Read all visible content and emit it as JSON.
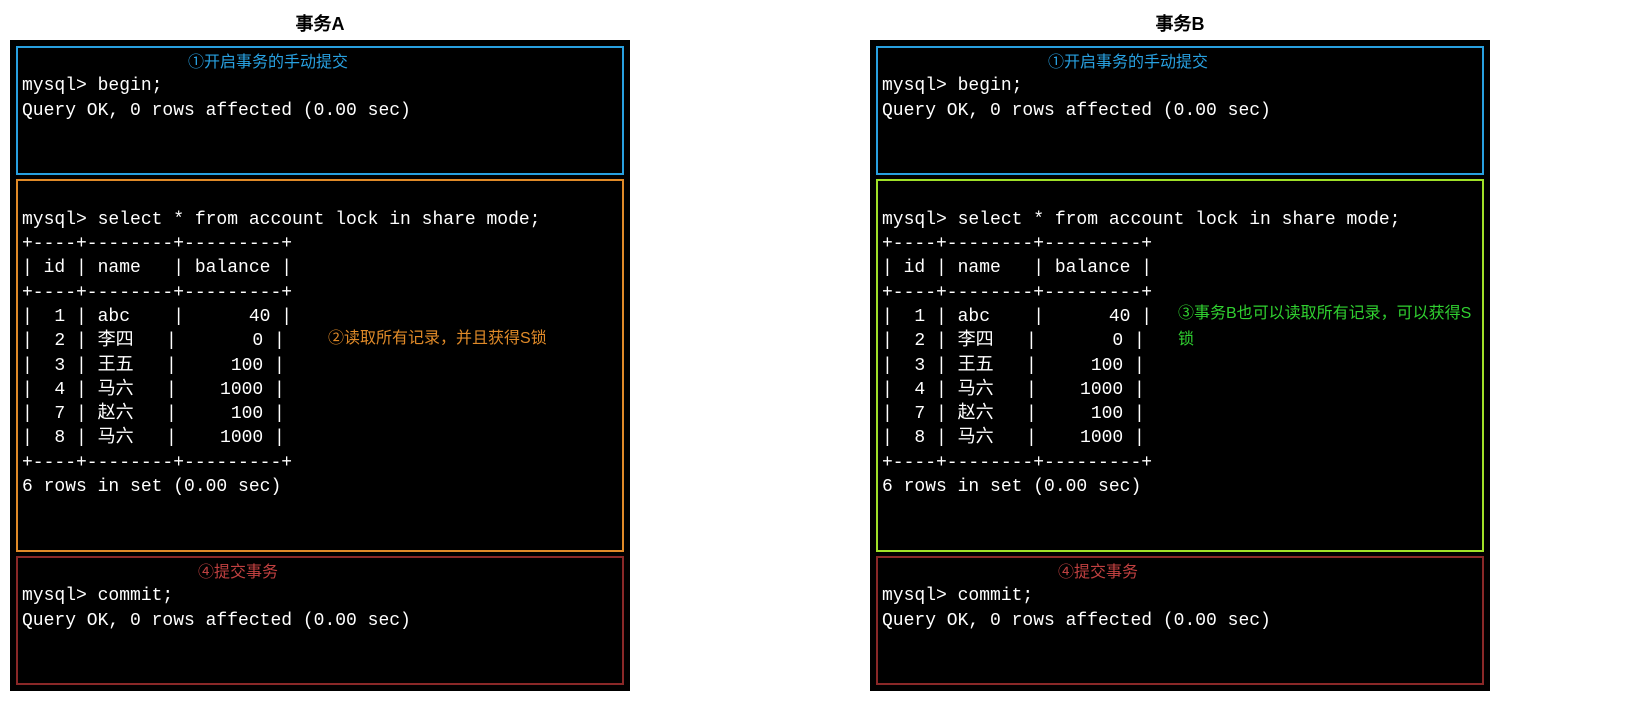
{
  "txA": {
    "title": "事务A",
    "begin": {
      "cmd": "mysql> begin;",
      "result": "Query OK, 0 rows affected (0.00 sec)",
      "annot": "①开启事务的手动提交"
    },
    "select": {
      "cmd": "mysql> select * from account lock in share mode;",
      "sep": "+----+--------+---------+",
      "header": "| id | name   | balance |",
      "rows": [
        "|  1 | abc    |      40 |",
        "|  2 | 李四   |       0 |",
        "|  3 | 王五   |     100 |",
        "|  4 | 马六   |    1000 |",
        "|  7 | 赵六   |     100 |",
        "|  8 | 马六   |    1000 |"
      ],
      "footer": "6 rows in set (0.00 sec)",
      "annot": "②读取所有记录，并且获得S锁"
    },
    "commit": {
      "cmd": "mysql> commit;",
      "result": "Query OK, 0 rows affected (0.00 sec)",
      "annot": "④提交事务"
    }
  },
  "txB": {
    "title": "事务B",
    "begin": {
      "cmd": "mysql> begin;",
      "result": "Query OK, 0 rows affected (0.00 sec)",
      "annot": "①开启事务的手动提交"
    },
    "select": {
      "cmd": "mysql> select * from account lock in share mode;",
      "sep": "+----+--------+---------+",
      "header": "| id | name   | balance |",
      "rows": [
        "|  1 | abc    |      40 |",
        "|  2 | 李四   |       0 |",
        "|  3 | 王五   |     100 |",
        "|  4 | 马六   |    1000 |",
        "|  7 | 赵六   |     100 |",
        "|  8 | 马六   |    1000 |"
      ],
      "footer": "6 rows in set (0.00 sec)",
      "annot": "③事务B也可以读取所有记录，可以获得S锁"
    },
    "commit": {
      "cmd": "mysql> commit;",
      "result": "Query OK, 0 rows affected (0.00 sec)",
      "annot": "④提交事务"
    }
  },
  "chart_data": {
    "type": "table",
    "title": "account",
    "columns": [
      "id",
      "name",
      "balance"
    ],
    "rows": [
      [
        1,
        "abc",
        40
      ],
      [
        2,
        "李四",
        0
      ],
      [
        3,
        "王五",
        100
      ],
      [
        4,
        "马六",
        1000
      ],
      [
        7,
        "赵六",
        100
      ],
      [
        8,
        "马六",
        1000
      ]
    ]
  }
}
